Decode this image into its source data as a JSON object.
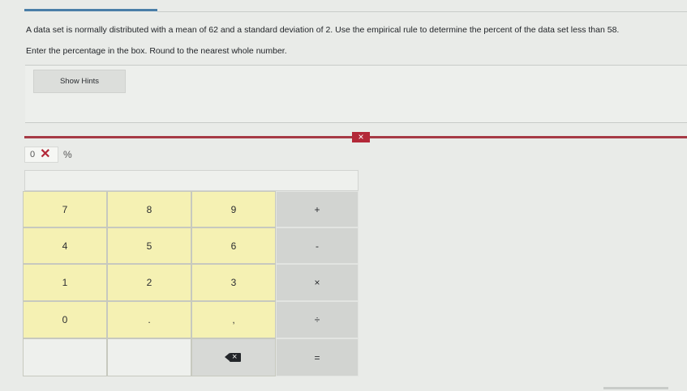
{
  "question": {
    "text": "A data set is normally distributed with a mean of 62 and a standard deviation of 2. Use the empirical rule to determine the percent of the data set less than 58.",
    "instruction": "Enter the percentage in the box. Round to the nearest whole number."
  },
  "hints": {
    "button_label": "Show Hints"
  },
  "calculator": {
    "close_label": "×",
    "answer": {
      "value": "0",
      "clear_symbol": "✕",
      "unit": "%"
    },
    "keys": {
      "k7": "7",
      "k8": "8",
      "k9": "9",
      "plus": "+",
      "k4": "4",
      "k5": "5",
      "k6": "6",
      "minus": "-",
      "k1": "1",
      "k2": "2",
      "k3": "3",
      "times": "×",
      "k0": "0",
      "dot": ".",
      "comma": ",",
      "divide": "÷",
      "equals": "="
    }
  },
  "colors": {
    "accent_blue": "#4a7ea8",
    "calc_red": "#a63a45",
    "close_red": "#b32838",
    "number_key": "#f5f1b3",
    "operator_key": "#d2d4d1"
  }
}
